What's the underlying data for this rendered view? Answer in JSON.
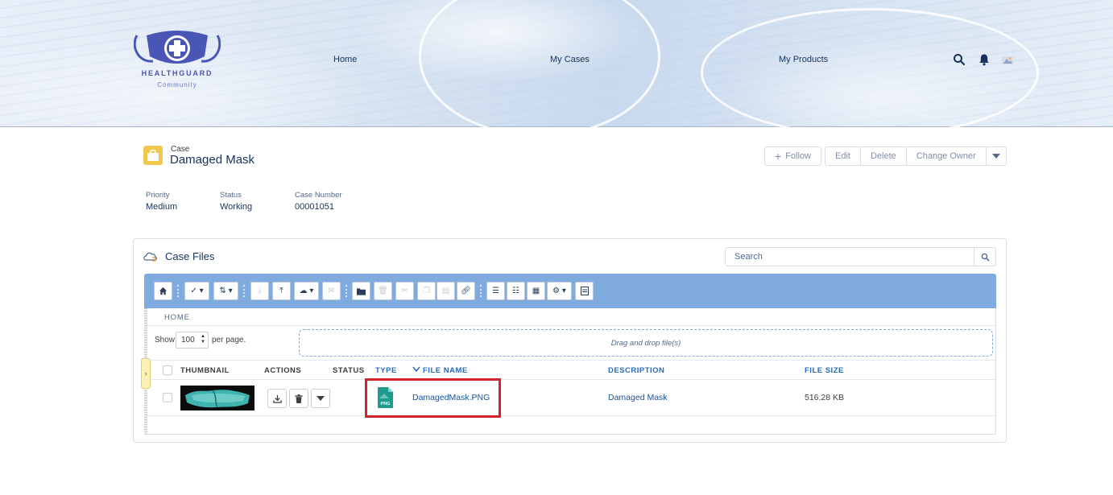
{
  "brand": {
    "name": "HEALTHGUARD",
    "sub": "Community"
  },
  "nav": {
    "home": "Home",
    "my_cases": "My Cases",
    "my_products": "My Products"
  },
  "header_icons": [
    "search-icon",
    "bell-icon",
    "user-avatar-icon"
  ],
  "record": {
    "object_label": "Case",
    "title": "Damaged Mask",
    "actions": {
      "follow": "Follow",
      "edit": "Edit",
      "delete": "Delete",
      "change_owner": "Change Owner"
    },
    "fields": [
      {
        "label": "Priority",
        "value": "Medium"
      },
      {
        "label": "Status",
        "value": "Working"
      },
      {
        "label": "Case Number",
        "value": "00001051"
      }
    ]
  },
  "case_files": {
    "title": "Case Files",
    "search_placeholder": "Search",
    "breadcrumb": "HOME",
    "show_label": "Show",
    "per_page_value": "100",
    "per_page_label": "per page.",
    "dropzone_text": "Drag and drop file(s)",
    "columns": {
      "thumbnail": "THUMBNAIL",
      "actions": "ACTIONS",
      "status": "STATUS",
      "type": "TYPE",
      "file_name": "FILE NAME",
      "description": "DESCRIPTION",
      "file_size": "FILE SIZE"
    },
    "rows": [
      {
        "file_type": "PNG",
        "file_name": "DamagedMask.PNG",
        "description": "Damaged Mask",
        "file_size": "516.28 KB"
      }
    ]
  },
  "colors": {
    "toolbar": "#7fabdf",
    "highlight": "#d4232b",
    "case_icon": "#f1c84b",
    "link": "#1b5297"
  }
}
